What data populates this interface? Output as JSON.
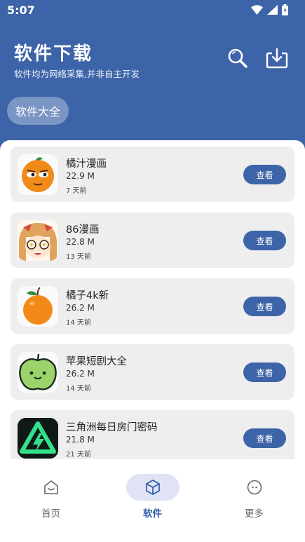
{
  "status_bar": {
    "time": "5:07"
  },
  "header": {
    "title": "软件下载",
    "subtitle": "软件均为网络采集,并非自主开发",
    "category_chip": "软件大全"
  },
  "apps": [
    {
      "name": "橘汁漫画",
      "size": "22.9 M",
      "date": "7 天前",
      "action": "查看",
      "icon": "orange-face-icon"
    },
    {
      "name": "86漫画",
      "size": "22.8 M",
      "date": "13 天前",
      "action": "查看",
      "icon": "anime-girl-icon"
    },
    {
      "name": "橘子4k新",
      "size": "26.2 M",
      "date": "14 天前",
      "action": "查看",
      "icon": "orange-fruit-icon"
    },
    {
      "name": "苹果短剧大全",
      "size": "26.2 M",
      "date": "14 天前",
      "action": "查看",
      "icon": "green-apple-icon"
    },
    {
      "name": "三角洲每日房门密码",
      "size": "21.8 M",
      "date": "21 天前",
      "action": "查看",
      "icon": "delta-logo-icon"
    }
  ],
  "tabs": [
    {
      "label": "首页",
      "icon": "home-icon",
      "active": false
    },
    {
      "label": "软件",
      "icon": "cube-icon",
      "active": true
    },
    {
      "label": "更多",
      "icon": "more-icon",
      "active": false
    }
  ],
  "colors": {
    "primary": "#3d64a8",
    "card": "#eeeeef",
    "active_tab_bg": "#dfe3f5"
  }
}
